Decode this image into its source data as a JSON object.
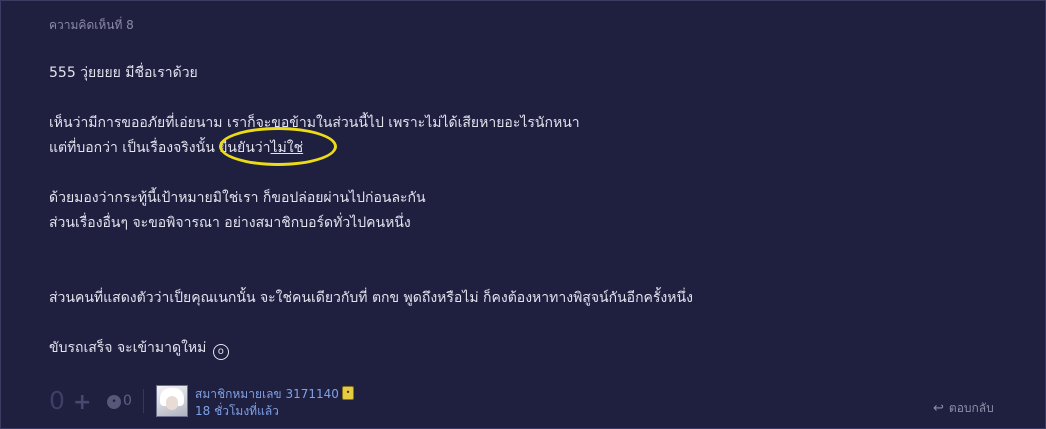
{
  "comment": {
    "header_label": "ความคิดเห็นที่ 8",
    "lines": [
      "555 วุ่ยยยย มีชื่อเราด้วย",
      "เห็นว่ามีการขออภัยที่เอ่ยนาม เราก็จะขอข้ามในส่วนนี้ไป เพราะไม่ได้เสียหายอะไรนักหนา",
      "แต่ที่บอกว่า เป็นเรื่องจริงนั้น ยืนยันว่า",
      "ไม่ใช่",
      "ด้วยมองว่ากระทู้นี้เป้าหมายมิใช่เรา ก็ขอปล่อยผ่านไปก่อนละกัน",
      "ส่วนเรื่องอื่นๆ จะขอพิจารณา อย่างสมาชิกบอร์ดทั่วไปคนหนึ่ง",
      "ส่วนคนที่แสดงตัวว่าเป็ยคุณเนกนั้น จะใช่คนเดียวกับที่ ตกข พูดถึงหรือไม่ ก็คงต้องหาทางพิสูจน์กันอีกครั้งหนึ่ง",
      "ขับรถเสร็จ จะเข้ามาดูใหม่"
    ],
    "annotation_color": "#ecdc17"
  },
  "footer": {
    "vote_count": "0",
    "plus_icon": "+",
    "emotion_count": "0",
    "member_name": "สมาชิกหมายเลข 3171140",
    "timestamp": "18 ชั่วโมงที่แล้ว",
    "reply_label": "ตอบกลับ",
    "reply_icon": "↩",
    "link_color": "#7ea2e6"
  },
  "colors": {
    "background": "#1f1f40",
    "text": "#e3e3ee",
    "muted": "#8b8ba6"
  }
}
